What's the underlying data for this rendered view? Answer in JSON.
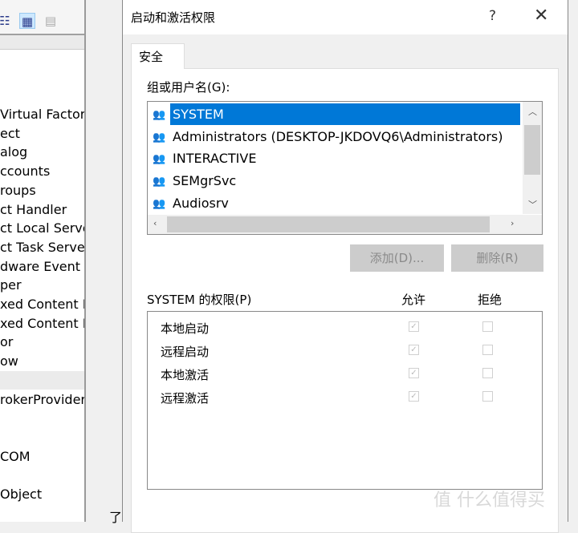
{
  "background_window": {
    "items": [
      "Virtual Factory",
      "ect",
      "alog",
      "ccounts",
      "roups",
      "ct Handler",
      "ct Local Server",
      "ct Task Server",
      "dware Event H.",
      "per",
      "xed Content H",
      "xed Content H",
      "or",
      "ow",
      "",
      "rokerProvider",
      "",
      "",
      "COM",
      "",
      "Object"
    ],
    "selected_index": 14,
    "stray_char": "了"
  },
  "dialog": {
    "title": "启动和激活权限",
    "help_label": "?",
    "close_label": "✕",
    "tab": "安全",
    "group_label": "组或用户名(G):",
    "groups": [
      {
        "name": "SYSTEM",
        "selected": true
      },
      {
        "name": "Administrators (DESKTOP-JKDOVQ6\\Administrators)"
      },
      {
        "name": "INTERACTIVE"
      },
      {
        "name": "SEMgrSvc"
      },
      {
        "name": "Audiosrv"
      }
    ],
    "add_button": "添加(D)...",
    "remove_button": "删除(R)",
    "perm_label": "SYSTEM 的权限(P)",
    "allow_header": "允许",
    "deny_header": "拒绝",
    "permissions": [
      {
        "name": "本地启动",
        "allow": true,
        "deny": false
      },
      {
        "name": "远程启动",
        "allow": true,
        "deny": false
      },
      {
        "name": "本地激活",
        "allow": true,
        "deny": false
      },
      {
        "name": "远程激活",
        "allow": true,
        "deny": false
      }
    ]
  },
  "watermark": "值 什么值得买",
  "colors": {
    "selection": "#0078d7",
    "disabled_button": "#cccccc"
  }
}
